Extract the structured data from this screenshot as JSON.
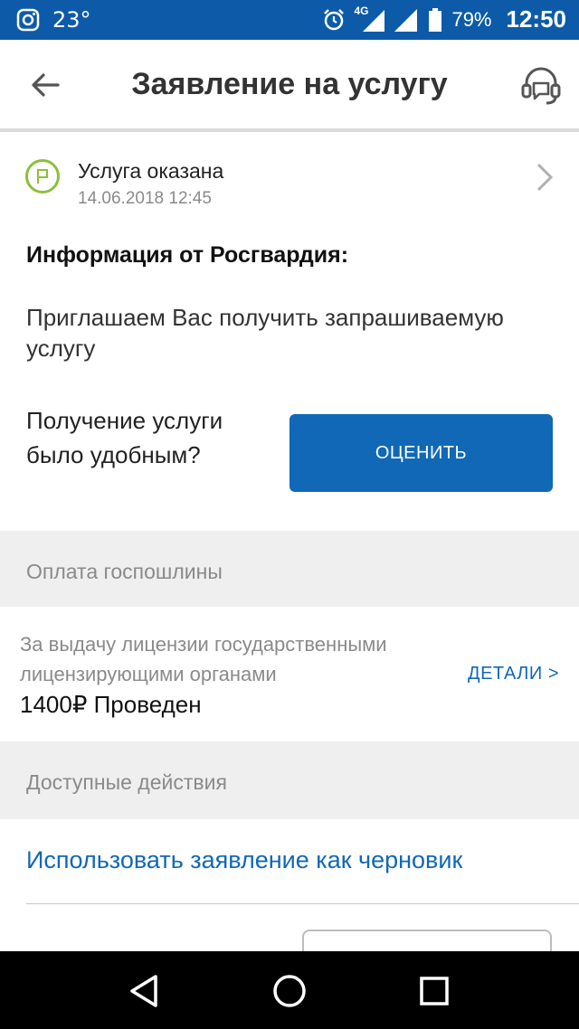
{
  "status_bar": {
    "temperature": "23°",
    "network": "4G",
    "battery": "79%",
    "time": "12:50"
  },
  "header": {
    "title": "Заявление на услугу"
  },
  "status": {
    "title": "Услуга оказана",
    "date": "14.06.2018 12:45",
    "color": "#8bbf3c"
  },
  "info": {
    "heading": "Информация от Росгвардия:",
    "text": "Приглашаем Вас получить запрашиваемую услугу"
  },
  "rating": {
    "question": "Получение услуги было удобным?",
    "button_label": "ОЦЕНИТЬ"
  },
  "payment_section": {
    "title": "Оплата госпошлины",
    "description": "За выдачу лицензии государственными лицензирующими органами",
    "amount_status": "1400₽ Проведен",
    "details_label": "ДЕТАЛИ >"
  },
  "actions_section": {
    "title": "Доступные действия",
    "draft_link": "Использовать заявление как черновик"
  },
  "colors": {
    "brand_blue": "#1068b7",
    "status_bar": "#0d5ba8",
    "section_bg": "#efefef"
  },
  "icons": [
    "instagram-icon",
    "alarm-icon",
    "signal-icon",
    "battery-icon",
    "back-arrow-icon",
    "support-headset-icon",
    "flag-icon",
    "chevron-right-icon",
    "nav-back-icon",
    "nav-home-icon",
    "nav-recents-icon"
  ]
}
